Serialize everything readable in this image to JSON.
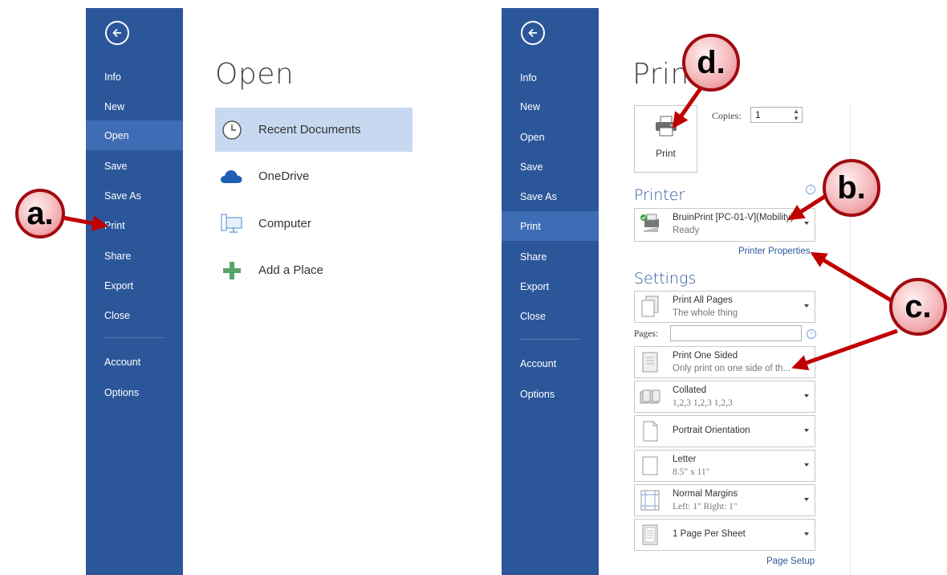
{
  "left_panel": {
    "nav": [
      "Info",
      "New",
      "Open",
      "Save",
      "Save As",
      "Print",
      "Share",
      "Export",
      "Close",
      "Account",
      "Options"
    ],
    "active": "Open",
    "title": "Open",
    "places": [
      "Recent Documents",
      "OneDrive",
      "Computer",
      "Add a Place"
    ]
  },
  "right_panel": {
    "nav": [
      "Info",
      "New",
      "Open",
      "Save",
      "Save As",
      "Print",
      "Share",
      "Export",
      "Close",
      "Account",
      "Options"
    ],
    "active": "Print",
    "title": "Print",
    "print_button": "Print",
    "copies_label": "Copies:",
    "copies_value": "1",
    "printer_heading": "Printer",
    "printer_name": "BruinPrint [PC-01-V](Mobility)",
    "printer_status": "Ready",
    "printer_properties": "Printer Properties",
    "settings_heading": "Settings",
    "pages_label": "Pages:",
    "settings": [
      {
        "main": "Print All Pages",
        "sub": "The whole thing"
      },
      {
        "main": "Print One Sided",
        "sub": "Only print on one side of th..."
      },
      {
        "main": "Collated",
        "sub": "1,2,3   1,2,3   1,2,3"
      },
      {
        "main": "Portrait Orientation",
        "sub": ""
      },
      {
        "main": "Letter",
        "sub": "8.5\" x 11\""
      },
      {
        "main": "Normal Margins",
        "sub": "Left: 1\"   Right: 1\""
      },
      {
        "main": "1 Page Per Sheet",
        "sub": ""
      }
    ],
    "page_setup": "Page Setup"
  },
  "callouts": {
    "a": "a.",
    "b": "b.",
    "c": "c.",
    "d": "d."
  },
  "colors": {
    "sidebar": "#2b579a",
    "sidebar_active": "#3e6db5",
    "place_active": "#c6d9f1",
    "callout_border": "#a10b10",
    "arrow": "#c00000"
  }
}
